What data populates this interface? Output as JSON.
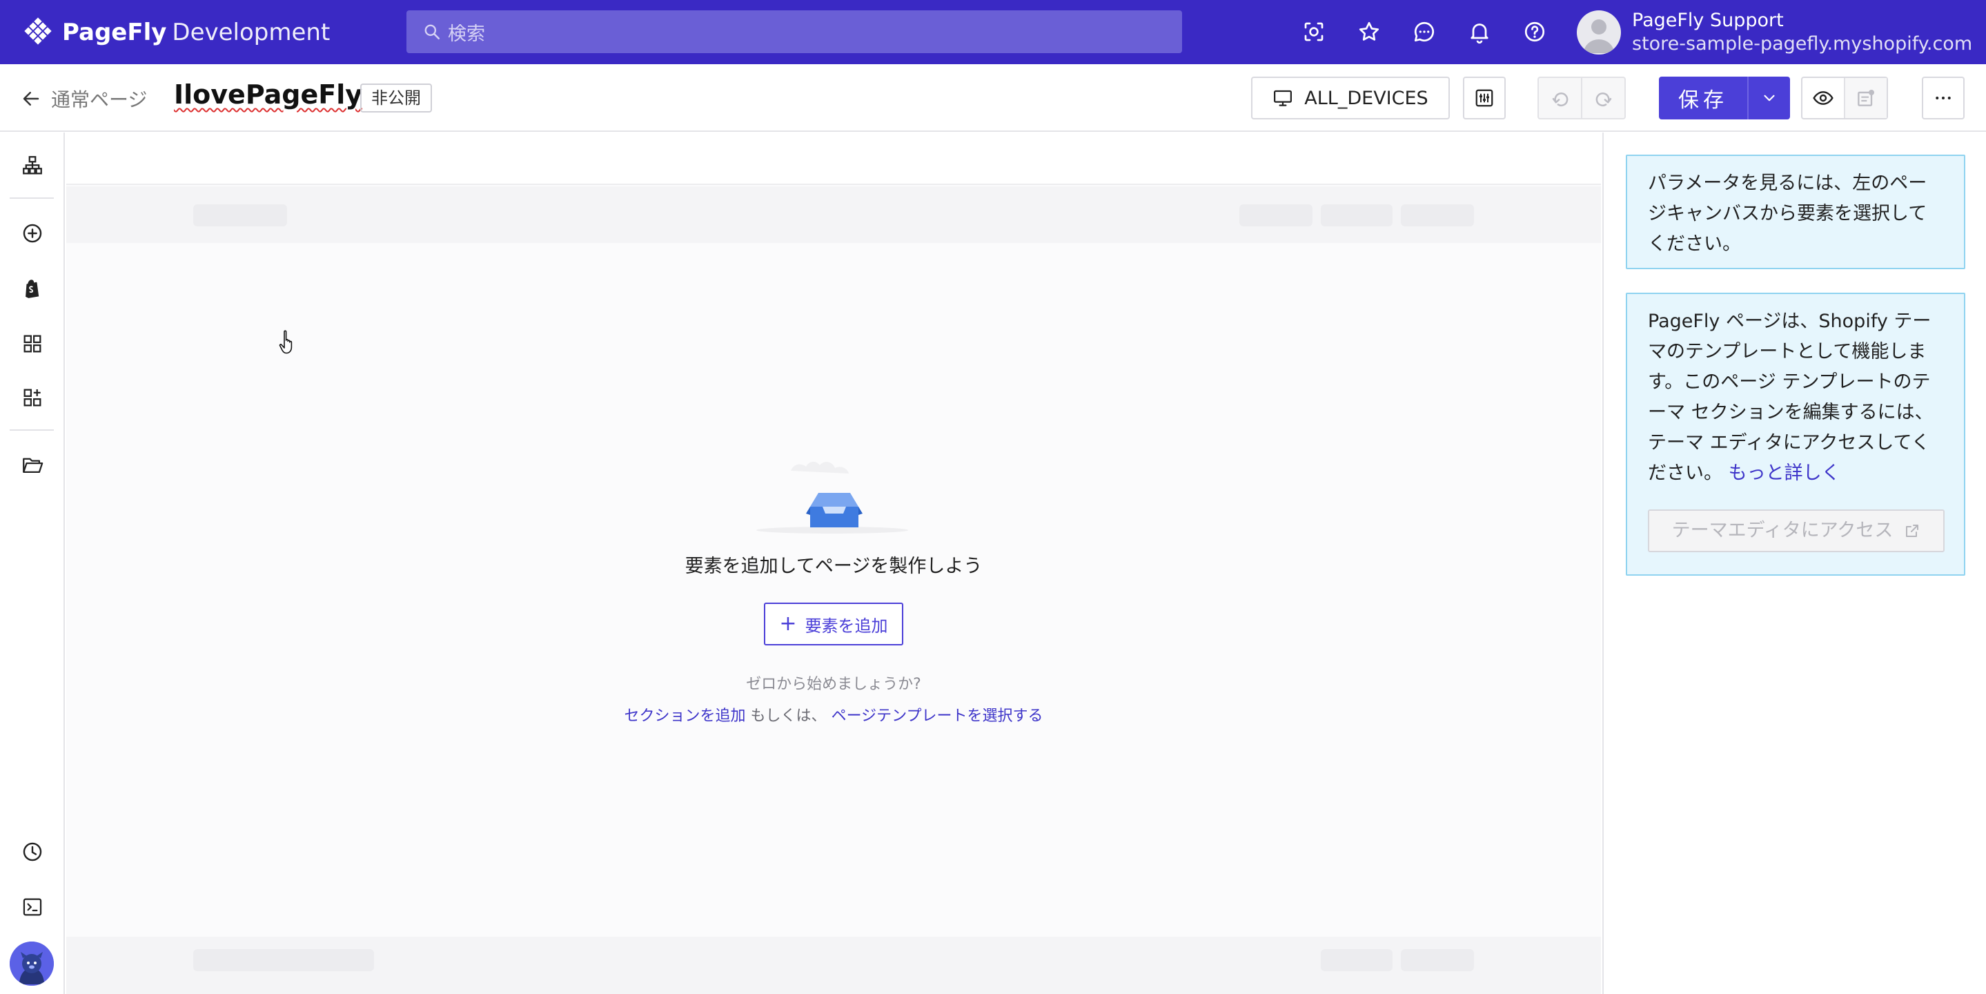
{
  "brand": {
    "name": "PageFly",
    "suffix": "Development"
  },
  "search": {
    "placeholder": "検索"
  },
  "user": {
    "name": "PageFly Support",
    "store": "store-sample-pagefly.myshopify.com"
  },
  "toolbar": {
    "back_label": "通常ページ",
    "page_title": "IlovePageFly",
    "status": "非公開",
    "device": "ALL_DEVICES",
    "save_label": "保存"
  },
  "canvas": {
    "empty_title": "要素を追加してページを製作しよう",
    "add_button": "要素を追加",
    "hint": "ゼロから始めましょうか?",
    "link_section": "セクションを追加",
    "or_text": "もしくは、",
    "link_template": "ページテンプレートを選択する"
  },
  "panel": {
    "info1": "パラメータを見るには、左のページキャンバスから要素を選択してください。",
    "info2": "PageFly ページは、Shopify テーマのテンプレートとして機能します。このページ テンプレートのテーマ セクションを編集するには、テーマ エディタにアクセスしてください。",
    "info2_link": "もっと詳しく",
    "theme_button": "テーマエディタにアクセス"
  },
  "icons": {
    "top": [
      "settings-scan-icon",
      "star-icon",
      "chat-icon",
      "bell-icon",
      "help-icon"
    ],
    "sidebar": [
      "layers-icon",
      "add-circle-icon",
      "shopify-bag-icon",
      "grid-icon",
      "widgets-icon",
      "folder-icon",
      "history-icon",
      "terminal-icon"
    ]
  },
  "colors": {
    "brand": "#3a29c4",
    "primary": "#4b3fd8",
    "info_bg": "#e6f6fd",
    "info_border": "#8fd3f0"
  }
}
